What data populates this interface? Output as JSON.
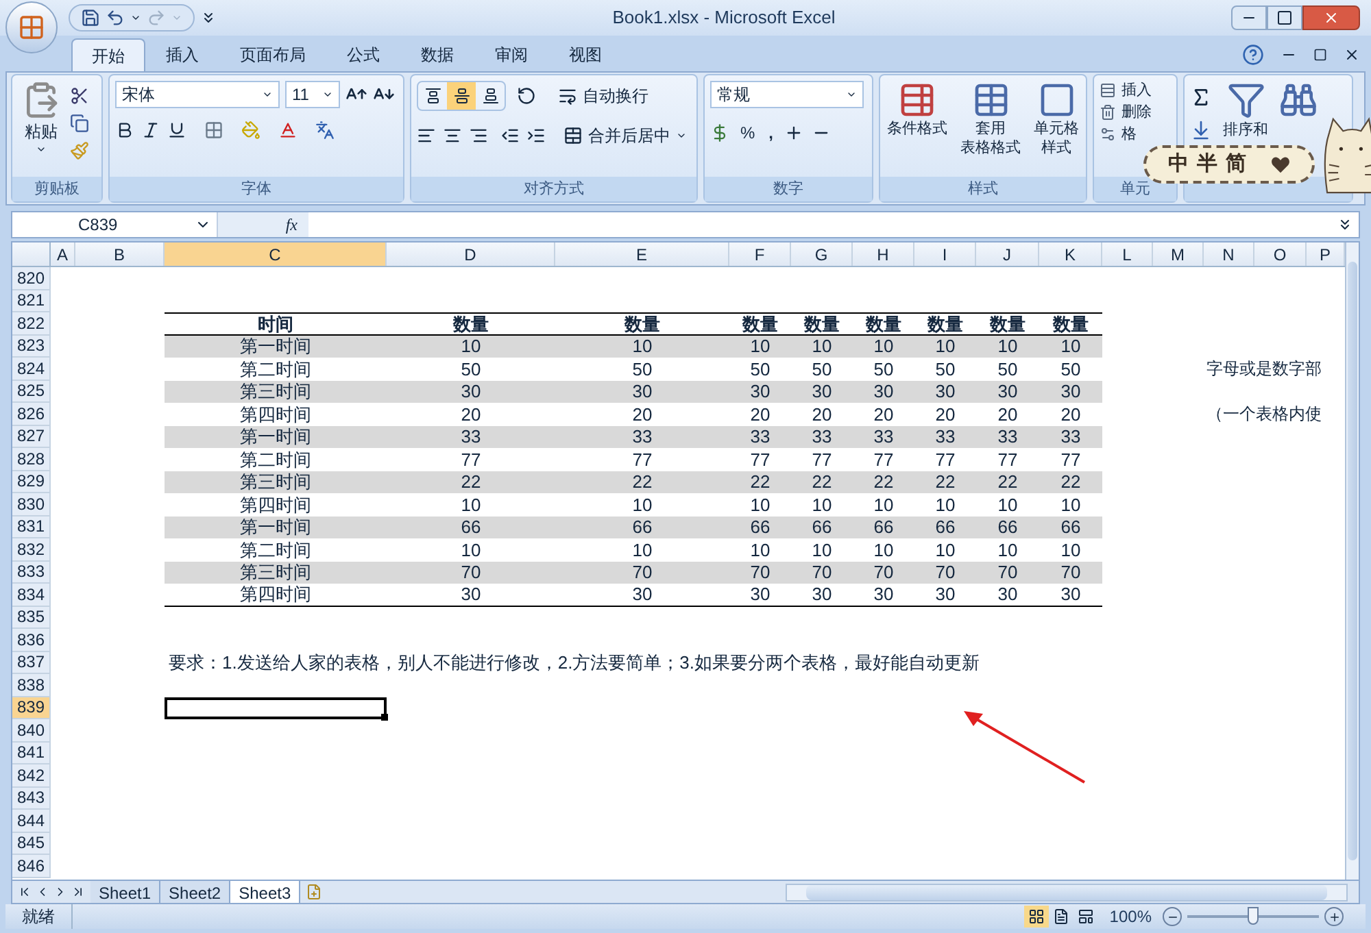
{
  "window": {
    "title": "Book1.xlsx - Microsoft Excel"
  },
  "ribbon_tabs": [
    {
      "label": "开始",
      "selected": true
    },
    {
      "label": "插入",
      "selected": false
    },
    {
      "label": "页面布局",
      "selected": false
    },
    {
      "label": "公式",
      "selected": false
    },
    {
      "label": "数据",
      "selected": false
    },
    {
      "label": "审阅",
      "selected": false
    },
    {
      "label": "视图",
      "selected": false
    }
  ],
  "clipboard": {
    "label": "剪贴板",
    "paste": "粘贴"
  },
  "font": {
    "label": "字体",
    "name": "宋体",
    "size": "11"
  },
  "alignment": {
    "label": "对齐方式",
    "wrap": "自动换行",
    "merge": "合并后居中",
    "vertical_align": [
      {
        "selected": false
      },
      {
        "selected": true
      },
      {
        "selected": false
      }
    ]
  },
  "number": {
    "label": "数字",
    "format": "常规",
    "percent": "%",
    "comma": ","
  },
  "styles": {
    "label": "样式",
    "buttons": [
      {
        "lines": [
          "条件格式"
        ]
      },
      {
        "lines": [
          "套用",
          "表格格式"
        ]
      },
      {
        "lines": [
          "单元格",
          "样式"
        ]
      }
    ]
  },
  "cells": {
    "label": "单元",
    "buttons": [
      "插入",
      "删除",
      "格"
    ]
  },
  "editing": {
    "sort": "排序和"
  },
  "ime": {
    "text": "中半简"
  },
  "formula_bar": {
    "name_box": "C839",
    "fx": "fx"
  },
  "columns": [
    {
      "label": "A",
      "selected": false
    },
    {
      "label": "B",
      "selected": false
    },
    {
      "label": "C",
      "selected": true
    },
    {
      "label": "D",
      "selected": false
    },
    {
      "label": "E",
      "selected": false
    },
    {
      "label": "F",
      "selected": false
    },
    {
      "label": "G",
      "selected": false
    },
    {
      "label": "H",
      "selected": false
    },
    {
      "label": "I",
      "selected": false
    },
    {
      "label": "J",
      "selected": false
    },
    {
      "label": "K",
      "selected": false
    },
    {
      "label": "L",
      "selected": false
    },
    {
      "label": "M",
      "selected": false
    },
    {
      "label": "N",
      "selected": false
    },
    {
      "label": "O",
      "selected": false
    },
    {
      "label": "P",
      "selected": false
    }
  ],
  "rows": [
    {
      "number": "820",
      "selected": false,
      "kind": "blank"
    },
    {
      "number": "821",
      "selected": false,
      "kind": "blank"
    },
    {
      "number": "822",
      "selected": false,
      "kind": "table_header",
      "values": [
        "时间",
        "数量",
        "数量",
        "数量",
        "数量",
        "数量",
        "数量",
        "数量",
        "数量"
      ]
    },
    {
      "number": "823",
      "selected": false,
      "kind": "table_row",
      "shaded": true,
      "values": [
        "第一时间",
        "10",
        "10",
        "10",
        "10",
        "10",
        "10",
        "10",
        "10"
      ]
    },
    {
      "number": "824",
      "selected": false,
      "kind": "table_row",
      "shaded": false,
      "values": [
        "第二时间",
        "50",
        "50",
        "50",
        "50",
        "50",
        "50",
        "50",
        "50"
      ],
      "side_text": "字母或是数字部"
    },
    {
      "number": "825",
      "selected": false,
      "kind": "table_row",
      "shaded": true,
      "values": [
        "第三时间",
        "30",
        "30",
        "30",
        "30",
        "30",
        "30",
        "30",
        "30"
      ]
    },
    {
      "number": "826",
      "selected": false,
      "kind": "table_row",
      "shaded": false,
      "values": [
        "第四时间",
        "20",
        "20",
        "20",
        "20",
        "20",
        "20",
        "20",
        "20"
      ],
      "side_text": "（一个表格内使"
    },
    {
      "number": "827",
      "selected": false,
      "kind": "table_row",
      "shaded": true,
      "values": [
        "第一时间",
        "33",
        "33",
        "33",
        "33",
        "33",
        "33",
        "33",
        "33"
      ]
    },
    {
      "number": "828",
      "selected": false,
      "kind": "table_row",
      "shaded": false,
      "values": [
        "第二时间",
        "77",
        "77",
        "77",
        "77",
        "77",
        "77",
        "77",
        "77"
      ]
    },
    {
      "number": "829",
      "selected": false,
      "kind": "table_row",
      "shaded": true,
      "values": [
        "第三时间",
        "22",
        "22",
        "22",
        "22",
        "22",
        "22",
        "22",
        "22"
      ]
    },
    {
      "number": "830",
      "selected": false,
      "kind": "table_row",
      "shaded": false,
      "values": [
        "第四时间",
        "10",
        "10",
        "10",
        "10",
        "10",
        "10",
        "10",
        "10"
      ]
    },
    {
      "number": "831",
      "selected": false,
      "kind": "table_row",
      "shaded": true,
      "values": [
        "第一时间",
        "66",
        "66",
        "66",
        "66",
        "66",
        "66",
        "66",
        "66"
      ]
    },
    {
      "number": "832",
      "selected": false,
      "kind": "table_row",
      "shaded": false,
      "values": [
        "第二时间",
        "10",
        "10",
        "10",
        "10",
        "10",
        "10",
        "10",
        "10"
      ]
    },
    {
      "number": "833",
      "selected": false,
      "kind": "table_row",
      "shaded": true,
      "values": [
        "第三时间",
        "70",
        "70",
        "70",
        "70",
        "70",
        "70",
        "70",
        "70"
      ]
    },
    {
      "number": "834",
      "selected": false,
      "kind": "table_row",
      "shaded": false,
      "values": [
        "第四时间",
        "30",
        "30",
        "30",
        "30",
        "30",
        "30",
        "30",
        "30"
      ]
    },
    {
      "number": "835",
      "selected": false,
      "kind": "blank"
    },
    {
      "number": "836",
      "selected": false,
      "kind": "blank"
    },
    {
      "number": "837",
      "selected": false,
      "kind": "note",
      "text": "要求：1.发送给人家的表格，别人不能进行修改，2.方法要简单；3.如果要分两个表格，最好能自动更新"
    },
    {
      "number": "838",
      "selected": false,
      "kind": "blank"
    },
    {
      "number": "839",
      "selected": true,
      "kind": "blank"
    },
    {
      "number": "840",
      "selected": false,
      "kind": "blank"
    },
    {
      "number": "841",
      "selected": false,
      "kind": "blank"
    },
    {
      "number": "842",
      "selected": false,
      "kind": "blank"
    },
    {
      "number": "843",
      "selected": false,
      "kind": "blank"
    },
    {
      "number": "844",
      "selected": false,
      "kind": "blank"
    },
    {
      "number": "845",
      "selected": false,
      "kind": "blank"
    },
    {
      "number": "846",
      "selected": false,
      "kind": "blank"
    }
  ],
  "sheet_tabs": [
    {
      "label": "Sheet1",
      "selected": false
    },
    {
      "label": "Sheet2",
      "selected": false
    },
    {
      "label": "Sheet3",
      "selected": true
    }
  ],
  "status_bar": {
    "state": "就绪",
    "views": [
      {
        "selected": true
      },
      {
        "selected": false
      },
      {
        "selected": false
      }
    ],
    "zoom": "100%",
    "zoom_slider": {
      "level": 0.5
    }
  }
}
